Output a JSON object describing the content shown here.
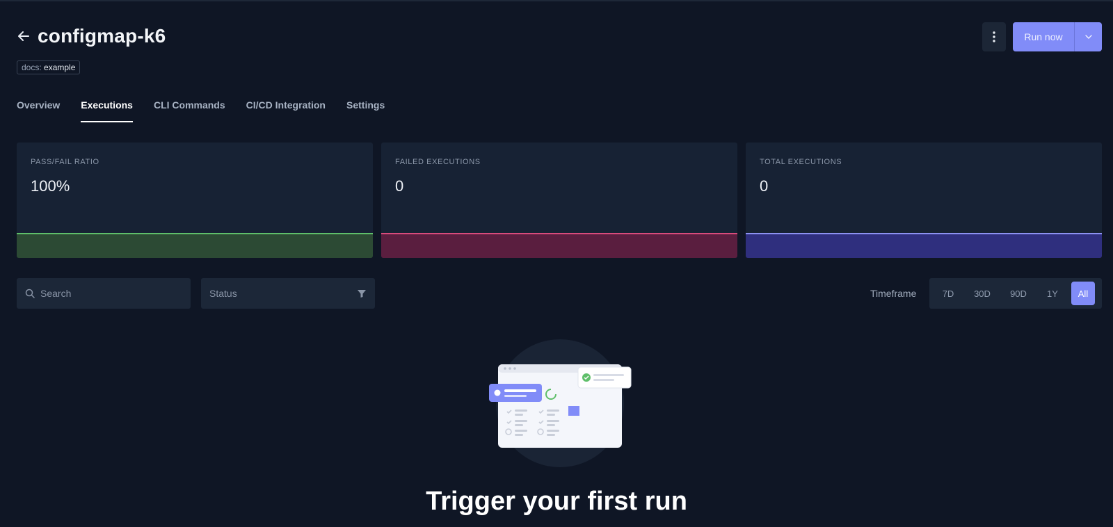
{
  "header": {
    "title": "configmap-k6",
    "label_key": "docs:",
    "label_value": "example",
    "run_label": "Run now"
  },
  "tabs": [
    {
      "label": "Overview",
      "active": false
    },
    {
      "label": "Executions",
      "active": true
    },
    {
      "label": "CLI Commands",
      "active": false
    },
    {
      "label": "CI/CD Integration",
      "active": false
    },
    {
      "label": "Settings",
      "active": false
    }
  ],
  "metrics": [
    {
      "label": "PASS/FAIL RATIO",
      "value": "100%",
      "bar_color": "#2c4a34",
      "line_color": "#5fbf6a"
    },
    {
      "label": "FAILED EXECUTIONS",
      "value": "0",
      "bar_color": "#5a1e3f",
      "line_color": "#d94b7c"
    },
    {
      "label": "TOTAL EXECUTIONS",
      "value": "0",
      "bar_color": "#2f2f7e",
      "line_color": "#8d92f2"
    }
  ],
  "filters": {
    "search_placeholder": "Search",
    "status_placeholder": "Status",
    "timeframe_label": "Timeframe",
    "timeframe_options": [
      {
        "label": "7D",
        "active": false
      },
      {
        "label": "30D",
        "active": false
      },
      {
        "label": "90D",
        "active": false
      },
      {
        "label": "1Y",
        "active": false
      },
      {
        "label": "All",
        "active": true
      }
    ]
  },
  "empty_state": {
    "title": "Trigger your first run"
  },
  "colors": {
    "accent": "#818cf8",
    "background": "#0f1625",
    "card": "#172234"
  }
}
